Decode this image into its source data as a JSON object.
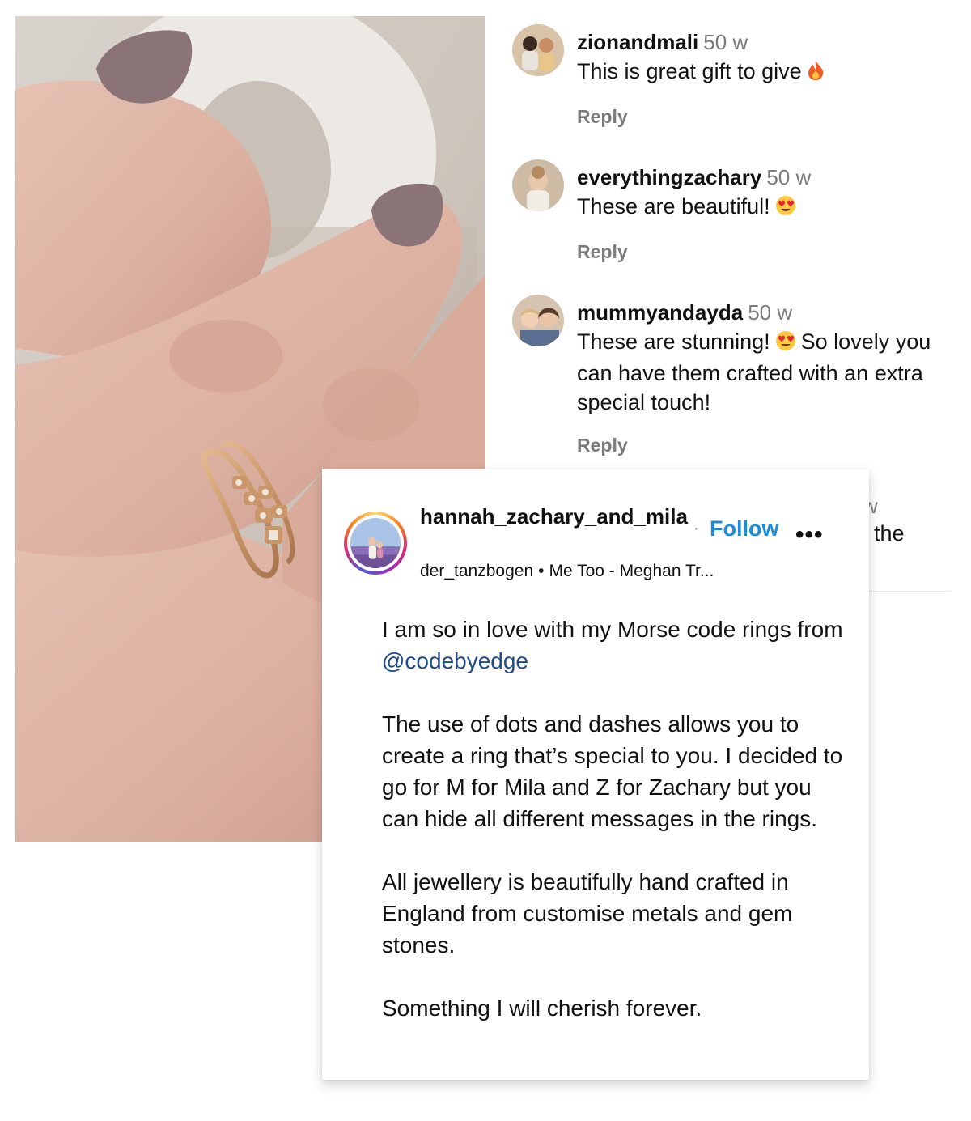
{
  "comments": [
    {
      "username": "zionandmali",
      "time": "50 w",
      "text": "This is great gift to give",
      "emoji": "fire-emoji",
      "reply": "Reply"
    },
    {
      "username": "everythingzachary",
      "time": "50 w",
      "text": "These are beautiful!",
      "emoji": "heart-eyes-emoji",
      "reply": "Reply"
    },
    {
      "username": "mummyandayda",
      "time": "50 w",
      "text_1": "These are stunning!",
      "emoji": "heart-eyes-emoji",
      "text_2": "So lovely you can have them crafted with an extra special touch!",
      "reply": "Reply"
    }
  ],
  "hidden_comment": {
    "time_fragment": "w",
    "text_fragment": "the"
  },
  "post": {
    "username": "hannah_zachary_and_mila",
    "follow_label": "Follow",
    "separator": "·",
    "more_label": "•••",
    "audio_author": "der_tanzbogen",
    "audio_separator": "•",
    "audio_track": "Me Too - Meghan Tr...",
    "caption": {
      "p1_text": "I am so in love with my Morse code rings from",
      "p1_mention": "@codebyedge",
      "p2": "The use of dots and dashes allows you to create a ring that’s special to you. I decided to go for M for Mila and Z for Zachary but you can hide all different messages in the rings.",
      "p3": "All jewellery is beautifully hand crafted in England from customise metals and gem stones.",
      "p4": "Something I will cherish forever."
    }
  },
  "colors": {
    "follow": "#1a8cd8",
    "muted": "#7b7b7b",
    "mention": "#1f4a8a",
    "nail": "#8a7478",
    "ring_gold": "#c9976a"
  }
}
